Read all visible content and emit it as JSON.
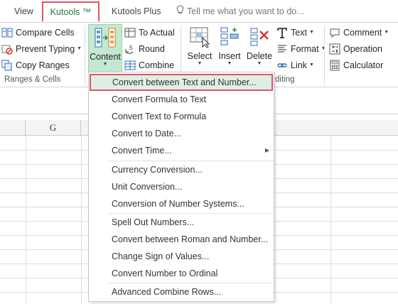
{
  "tabs": {
    "view": "View",
    "kutools": "Kutools ™",
    "kutools_plus": "Kutools Plus",
    "tell_me": "Tell me what you want to do..."
  },
  "ribbon": {
    "ranges_cells": {
      "compare_cells": "Compare Cells",
      "prevent_typing": "Prevent Typing",
      "copy_ranges": "Copy Ranges",
      "group_label": "Ranges & Cells"
    },
    "content": {
      "label": "Content",
      "to_actual": "To Actual",
      "round": "Round",
      "combine": "Combine"
    },
    "editing": {
      "select": "Select",
      "insert": "Insert",
      "delete": "Delete",
      "text": "Text",
      "format": "Format",
      "link": "Link",
      "comment": "Comment",
      "operation": "Operation",
      "calculator": "Calculator",
      "group_label": "diting"
    }
  },
  "sheet": {
    "column_g": "G"
  },
  "menu": {
    "items": [
      "Convert between Text and Number...",
      "Convert Formula to Text",
      "Convert Text to Formula",
      "Convert to Date...",
      "Convert Time...",
      "Currency Conversion...",
      "Unit Conversion...",
      "Conversion of Number Systems...",
      "Spell Out Numbers...",
      "Convert between Roman and Number...",
      "Change Sign of Values...",
      "Convert Number to Ordinal",
      "Advanced Combine Rows..."
    ]
  },
  "colors": {
    "accent_green": "#1f7a3a",
    "highlight_border": "#e05466",
    "highlight_fill": "#ddf0e3",
    "content_button_fill": "#c5e8d0"
  }
}
